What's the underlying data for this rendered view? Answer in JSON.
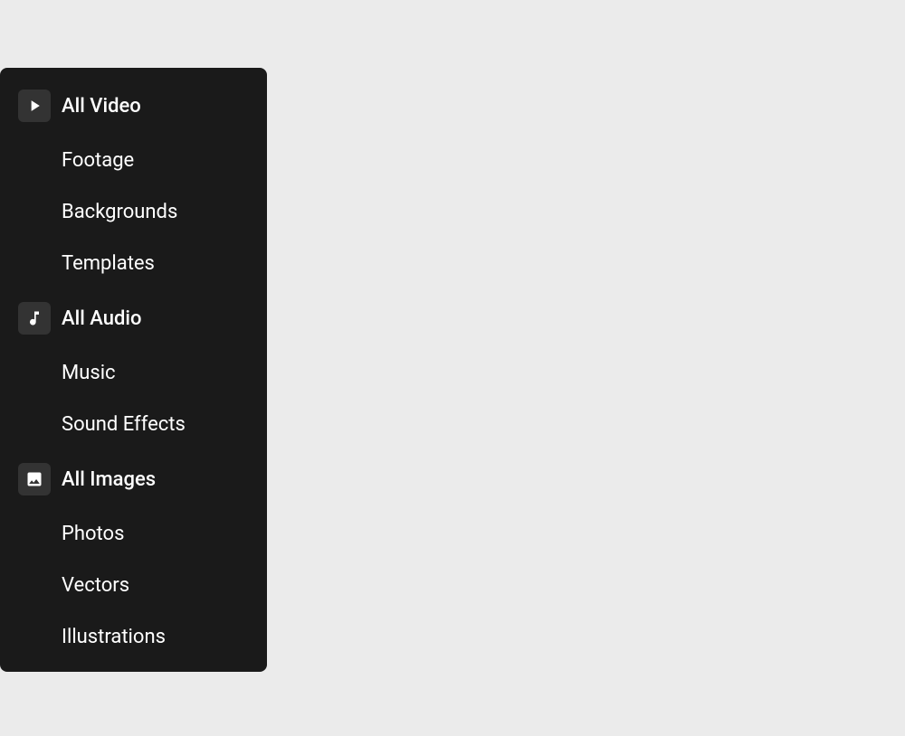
{
  "sidebar": {
    "background_color": "#1a1a1a",
    "sections": [
      {
        "id": "video",
        "header_label": "All Video",
        "icon": "play-icon",
        "sub_items": [
          {
            "id": "footage",
            "label": "Footage"
          },
          {
            "id": "backgrounds",
            "label": "Backgrounds"
          },
          {
            "id": "templates",
            "label": "Templates"
          }
        ]
      },
      {
        "id": "audio",
        "header_label": "All Audio",
        "icon": "music-icon",
        "sub_items": [
          {
            "id": "music",
            "label": "Music"
          },
          {
            "id": "sound-effects",
            "label": "Sound Effects"
          }
        ]
      },
      {
        "id": "images",
        "header_label": "All Images",
        "icon": "image-icon",
        "sub_items": [
          {
            "id": "photos",
            "label": "Photos"
          },
          {
            "id": "vectors",
            "label": "Vectors"
          },
          {
            "id": "illustrations",
            "label": "Illustrations"
          }
        ]
      }
    ]
  }
}
